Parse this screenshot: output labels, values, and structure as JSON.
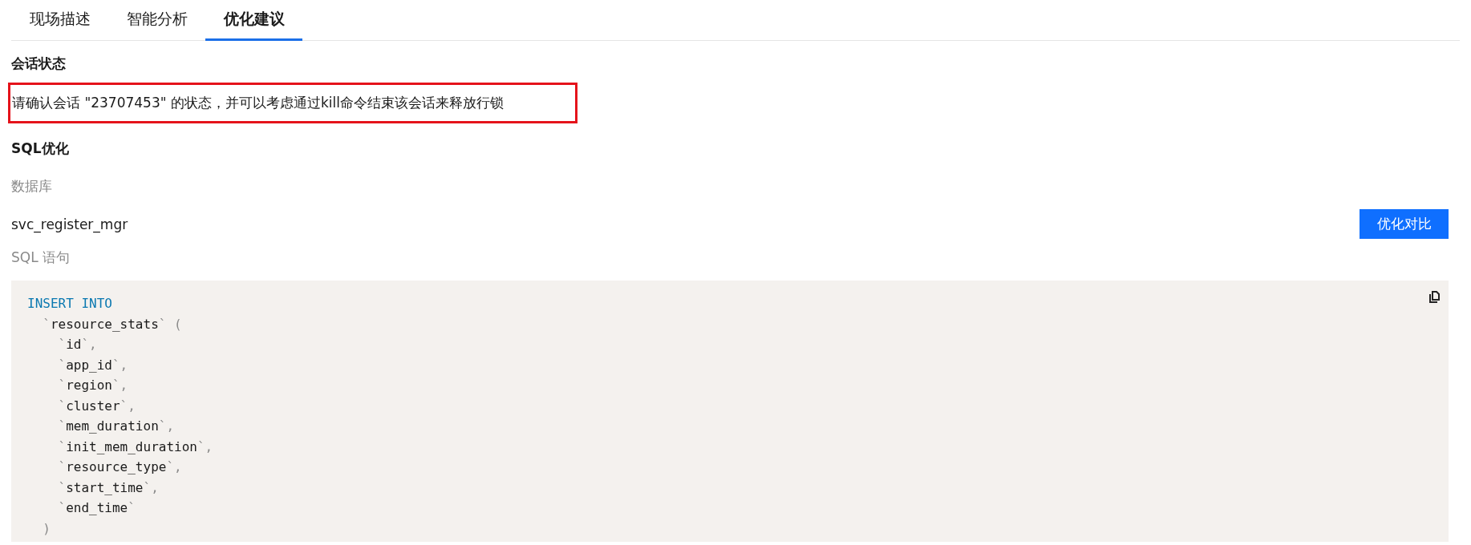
{
  "tabs": [
    {
      "label": "现场描述",
      "selected": false
    },
    {
      "label": "智能分析",
      "selected": false
    },
    {
      "label": "优化建议",
      "selected": true
    }
  ],
  "session": {
    "title": "会话状态",
    "advice": "请确认会话 \"23707453\" 的状态，并可以考虑通过kill命令结束该会话来释放行锁",
    "highlighted": true
  },
  "sql": {
    "title": "SQL优化",
    "database_label": "数据库",
    "database": "svc_register_mgr",
    "compare_button": "优化对比",
    "statement_label": "SQL 语句",
    "code": [
      [
        {
          "kind": "keyword",
          "text": "INSERT INTO"
        }
      ],
      [
        {
          "kind": "punct",
          "text": "  `"
        },
        {
          "kind": "ident",
          "text": "resource_stats"
        },
        {
          "kind": "punct",
          "text": "` ("
        }
      ],
      [
        {
          "kind": "punct",
          "text": "    `"
        },
        {
          "kind": "ident",
          "text": "id"
        },
        {
          "kind": "punct",
          "text": "`,"
        }
      ],
      [
        {
          "kind": "punct",
          "text": "    `"
        },
        {
          "kind": "ident",
          "text": "app_id"
        },
        {
          "kind": "punct",
          "text": "`,"
        }
      ],
      [
        {
          "kind": "punct",
          "text": "    `"
        },
        {
          "kind": "ident",
          "text": "region"
        },
        {
          "kind": "punct",
          "text": "`,"
        }
      ],
      [
        {
          "kind": "punct",
          "text": "    `"
        },
        {
          "kind": "ident",
          "text": "cluster"
        },
        {
          "kind": "punct",
          "text": "`,"
        }
      ],
      [
        {
          "kind": "punct",
          "text": "    `"
        },
        {
          "kind": "ident",
          "text": "mem_duration"
        },
        {
          "kind": "punct",
          "text": "`,"
        }
      ],
      [
        {
          "kind": "punct",
          "text": "    `"
        },
        {
          "kind": "ident",
          "text": "init_mem_duration"
        },
        {
          "kind": "punct",
          "text": "`,"
        }
      ],
      [
        {
          "kind": "punct",
          "text": "    `"
        },
        {
          "kind": "ident",
          "text": "resource_type"
        },
        {
          "kind": "punct",
          "text": "`,"
        }
      ],
      [
        {
          "kind": "punct",
          "text": "    `"
        },
        {
          "kind": "ident",
          "text": "start_time"
        },
        {
          "kind": "punct",
          "text": "`,"
        }
      ],
      [
        {
          "kind": "punct",
          "text": "    `"
        },
        {
          "kind": "ident",
          "text": "end_time"
        },
        {
          "kind": "punct",
          "text": "`"
        }
      ],
      [
        {
          "kind": "punct",
          "text": "  )"
        }
      ]
    ]
  }
}
